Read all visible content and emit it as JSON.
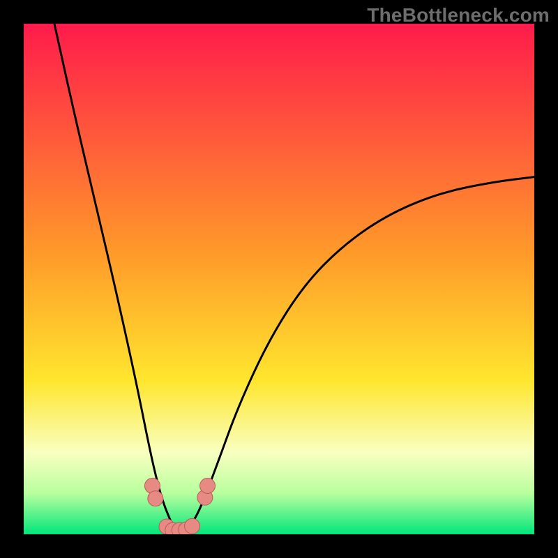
{
  "watermark": "TheBottleneck.com",
  "colors": {
    "frame": "#000000",
    "gradient_top": "#ff1b4b",
    "gradient_mid1": "#ff7a2a",
    "gradient_mid2": "#ffe62e",
    "gradient_low": "#f7ffb0",
    "gradient_green1": "#6ff08a",
    "gradient_green2": "#00e67a",
    "curve": "#000000",
    "markers": "#e78a83",
    "marker_stroke": "#b85c57"
  },
  "chart_data": {
    "type": "line",
    "title": "",
    "xlabel": "",
    "ylabel": "",
    "xlim": [
      0,
      100
    ],
    "ylim": [
      0,
      100
    ],
    "grid": false,
    "legend": false,
    "series": [
      {
        "name": "bottleneck-curve",
        "x": [
          6,
          10,
          14,
          18,
          22,
          25,
          27,
          29,
          30,
          31,
          33,
          35,
          38,
          42,
          48,
          55,
          63,
          72,
          82,
          92,
          100
        ],
        "y": [
          100,
          82,
          65,
          48,
          30,
          15,
          7,
          2,
          0.5,
          0.5,
          2,
          6,
          14,
          25,
          38,
          49,
          57,
          63,
          67,
          69,
          70
        ]
      }
    ],
    "markers": [
      {
        "x": 25.2,
        "y": 9.5
      },
      {
        "x": 25.8,
        "y": 7.0
      },
      {
        "x": 28.0,
        "y": 1.5
      },
      {
        "x": 29.2,
        "y": 0.8
      },
      {
        "x": 30.5,
        "y": 0.8
      },
      {
        "x": 31.8,
        "y": 0.9
      },
      {
        "x": 33.0,
        "y": 1.6
      },
      {
        "x": 35.5,
        "y": 7.2
      },
      {
        "x": 36.0,
        "y": 9.5
      }
    ],
    "background_gradient_stops": [
      {
        "pct": 0,
        "color": "#ff1b4b"
      },
      {
        "pct": 45,
        "color": "#ff9a2a"
      },
      {
        "pct": 70,
        "color": "#ffe62e"
      },
      {
        "pct": 84,
        "color": "#f9ffc0"
      },
      {
        "pct": 92,
        "color": "#b8ff9e"
      },
      {
        "pct": 100,
        "color": "#00e67a"
      }
    ]
  }
}
